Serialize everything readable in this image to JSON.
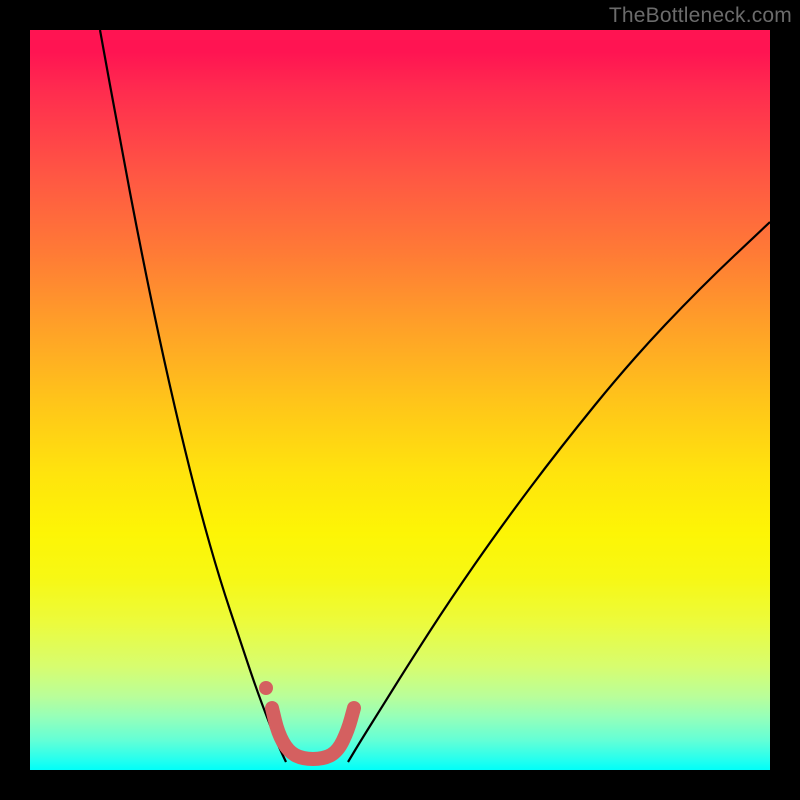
{
  "watermark": "TheBottleneck.com",
  "domain_x": {
    "min": 0,
    "max": 740
  },
  "domain_y": {
    "min": 0,
    "max": 740
  },
  "chart_data": {
    "type": "line",
    "title": "",
    "xlabel": "",
    "ylabel": "",
    "series": [
      {
        "name": "left-curve",
        "stroke": "#000000",
        "stroke_width": 2.2,
        "x": [
          70,
          90,
          110,
          130,
          150,
          170,
          190,
          210,
          225,
          238,
          248,
          256
        ],
        "y": [
          0,
          110,
          215,
          312,
          400,
          480,
          550,
          610,
          655,
          690,
          715,
          732
        ]
      },
      {
        "name": "right-curve",
        "stroke": "#000000",
        "stroke_width": 2.2,
        "x": [
          318,
          330,
          350,
          380,
          420,
          470,
          530,
          600,
          670,
          740
        ],
        "y": [
          732,
          712,
          680,
          632,
          570,
          498,
          418,
          332,
          258,
          192
        ]
      },
      {
        "name": "trough-marker",
        "stroke": "#d46060",
        "stroke_width": 14,
        "linecap": "round",
        "x": [
          242,
          248,
          258,
          272,
          294,
          308,
          318,
          324
        ],
        "y": [
          678,
          703,
          721,
          729,
          729,
          721,
          700,
          678
        ]
      },
      {
        "name": "left-dot",
        "type": "dot",
        "fill": "#d46060",
        "r": 7,
        "cx": 236,
        "cy": 658
      }
    ],
    "gradient_stops": [
      {
        "pos": 0.0,
        "color": "#ff1452"
      },
      {
        "pos": 0.5,
        "color": "#ffc41a"
      },
      {
        "pos": 0.8,
        "color": "#ecfb3c"
      },
      {
        "pos": 1.0,
        "color": "#00fff9"
      }
    ]
  }
}
